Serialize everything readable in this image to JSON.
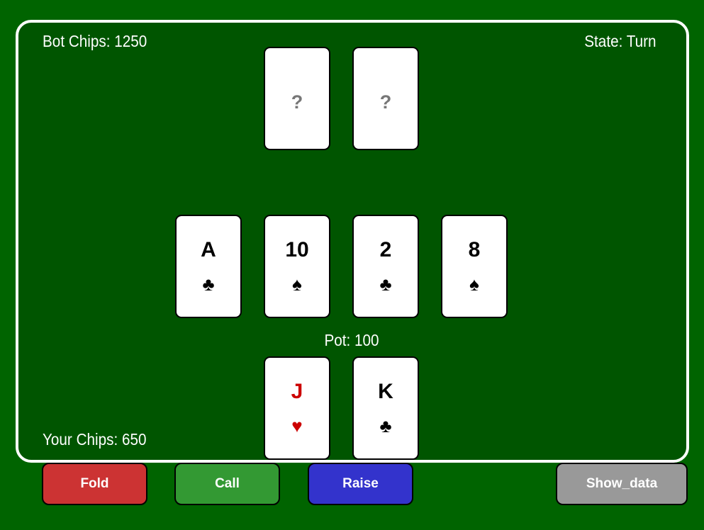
{
  "table": {
    "bot_chips": "Bot Chips: 1250",
    "state": "State: Turn",
    "pot": "Pot: 100",
    "your_chips": "Your Chips: 650"
  },
  "bot_hand": [
    {
      "rank": "?",
      "suit": ""
    },
    {
      "rank": "?",
      "suit": ""
    }
  ],
  "community": [
    {
      "rank": "A",
      "suit": "♣"
    },
    {
      "rank": "10",
      "suit": "♠"
    },
    {
      "rank": "2",
      "suit": "♣"
    },
    {
      "rank": "8",
      "suit": "♠"
    }
  ],
  "player_hand": [
    {
      "rank": "J",
      "suit": "♥"
    },
    {
      "rank": "K",
      "suit": "♣"
    }
  ],
  "buttons": {
    "fold": "Fold",
    "call": "Call",
    "raise": "Raise",
    "show_data": "Show_data"
  },
  "colors": {
    "background": "#006400",
    "felt": "#005500",
    "fold": "#cc3333",
    "call": "#339933",
    "raise": "#3333cc",
    "show_data": "#999999",
    "red_suit": "#cc0000"
  }
}
